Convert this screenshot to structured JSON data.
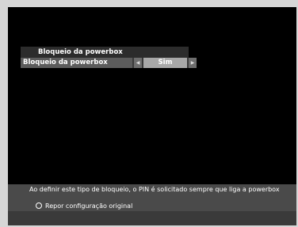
{
  "menu": {
    "title": "Bloqueio da powerbox",
    "row_label": "Bloqueio da powerbox",
    "row_value": "Sim",
    "left_arrow_icon": "arrow-left-icon",
    "right_arrow_icon": "arrow-right-icon"
  },
  "info": {
    "text": "Ao definir este tipo de bloqueio, o PIN é solicitado sempre que liga a powerbox",
    "reset_label": "Repor configuração original",
    "reset_icon": "button-circle-icon"
  },
  "colors": {
    "screen_bg": "#000000",
    "title_bg": "#2c2c2c",
    "row_bg": "#5c5c5c",
    "value_bg": "#a8a8a8",
    "info_bg": "#4a4a4a"
  }
}
